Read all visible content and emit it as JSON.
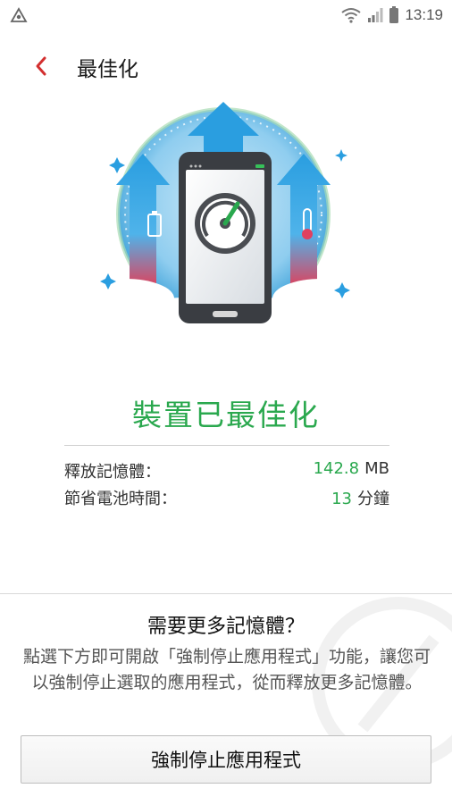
{
  "status_bar": {
    "time": "13:19",
    "icons": [
      "notification-icon",
      "wifi-icon",
      "signal-icon",
      "battery-icon"
    ]
  },
  "app_bar": {
    "title": "最佳化",
    "back_icon": "chevron-left-icon"
  },
  "colors": {
    "accent_green": "#2aa84e",
    "back_red": "#d32f2f"
  },
  "result": {
    "title": "裝置已最佳化",
    "stats": [
      {
        "label": "釋放記憶體：",
        "value": "142.8",
        "unit": "MB"
      },
      {
        "label": "節省電池時間：",
        "value": "13",
        "unit": "分鐘"
      }
    ]
  },
  "promo": {
    "title": "需要更多記憶體？",
    "description": "點選下方即可開啟「強制停止應用程式」功能，讓您可以強制停止選取的應用程式，從而釋放更多記憶體。",
    "button_label": "強制停止應用程式"
  }
}
